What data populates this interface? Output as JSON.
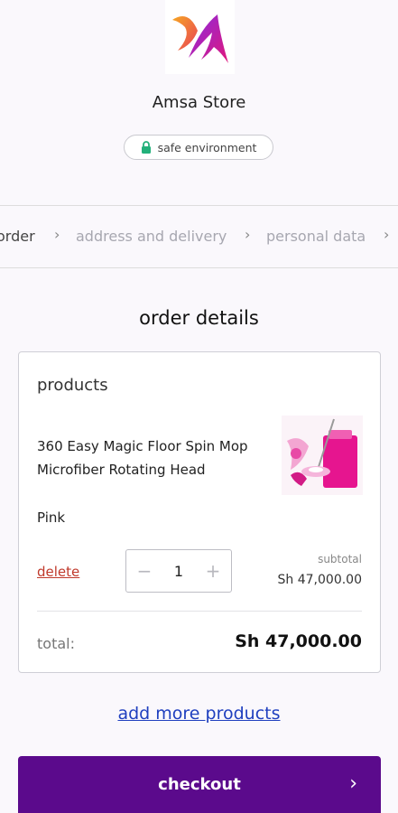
{
  "header": {
    "store_name": "Amsa Store",
    "safe_badge": "safe environment",
    "lock_icon": "lock-icon"
  },
  "steps": {
    "items": [
      "order",
      "address and delivery",
      "personal data"
    ],
    "active_index": 0
  },
  "order": {
    "title": "order details",
    "products_label": "products",
    "product": {
      "name": "360 Easy Magic Floor Spin Mop Microfiber Rotating Head",
      "variant": "Pink",
      "delete_label": "delete",
      "quantity": "1",
      "decrement_symbol": "−",
      "increment_symbol": "+",
      "subtotal_label": "subtotal",
      "subtotal_value": "Sh 47,000.00"
    },
    "total_label": "total:",
    "total_value": "Sh 47,000.00"
  },
  "actions": {
    "add_more_label": "add more products",
    "checkout_label": "checkout",
    "checkout_arrow": "›"
  },
  "colors": {
    "accent": "#5b0a8c",
    "delete": "#c0392b",
    "link": "#1f3fbf",
    "safe_lock": "#22b07a"
  }
}
